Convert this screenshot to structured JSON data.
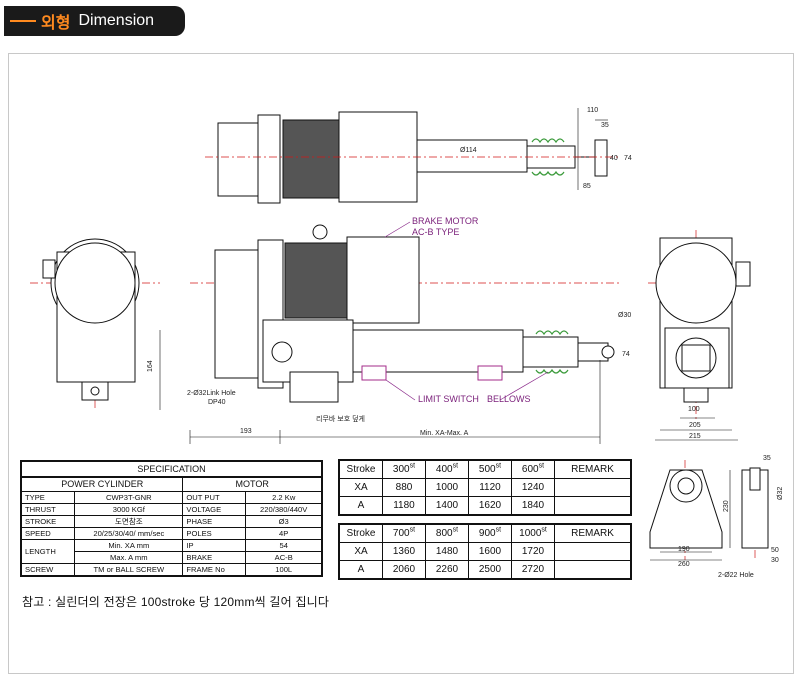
{
  "header": {
    "korean": "외형",
    "english": "Dimension"
  },
  "drawing": {
    "top_view": {
      "dim_110": "110",
      "dim_35": "35",
      "dim_40": "40",
      "dim_74": "74",
      "dim_85": "85",
      "dim_phi114": "Ø114"
    },
    "side_view": {
      "brake_motor_label": "BRAKE MOTOR",
      "brake_motor_type": "AC-B TYPE",
      "limit_switch_label": "LIMIT SWITCH",
      "bellows_label": "BELLOWS",
      "hole_label_1": "2-Ø32Link Hole",
      "hole_label_2": "DP40",
      "dim_164": "164",
      "dim_193": "193",
      "dim_phi30": "Ø30",
      "dim_74": "74",
      "length_label": "Min. XA-Max. A",
      "cover_label": "리무바 보호 덮게"
    },
    "end_view": {
      "dim_100": "100",
      "dim_205": "205",
      "dim_215": "215"
    },
    "bracket": {
      "dim_35": "35",
      "dim_230": "230",
      "dim_phi32": "Ø32",
      "dim_190": "190",
      "dim_260": "260",
      "dim_50": "50",
      "dim_30": "30",
      "hole_label": "2-Ø22 Hole"
    }
  },
  "spec_table": {
    "title": "SPECIFICATION",
    "col_power": "POWER CYLINDER",
    "col_motor": "MOTOR",
    "rows": [
      {
        "label": "TYPE",
        "value": "CWP3T-GNR",
        "mlabel": "OUT PUT",
        "mvalue": "2.2 Kw"
      },
      {
        "label": "THRUST",
        "value": "3000 KGf",
        "mlabel": "VOLTAGE",
        "mvalue": "220/380/440V"
      },
      {
        "label": "STROKE",
        "value": "도면참조",
        "mlabel": "PHASE",
        "mvalue": "Ø3"
      },
      {
        "label": "SPEED",
        "value": "20/25/30/40/ mm/sec",
        "mlabel": "POLES",
        "mvalue": "4P"
      }
    ],
    "length_label": "LENGTH",
    "length_rows": [
      {
        "value": "Min. XA mm",
        "mlabel": "IP",
        "mvalue": "54"
      },
      {
        "value": "Max. A mm",
        "mlabel": "BRAKE",
        "mvalue": "AC-B"
      }
    ],
    "last_row": {
      "label": "SCREW",
      "value": "TM or BALL SCREW",
      "mlabel": "FRAME No",
      "mvalue": "100L"
    }
  },
  "stroke_tables": [
    {
      "head": "Stroke",
      "sup": "st",
      "remark": "REMARK",
      "strokes": [
        "300",
        "400",
        "500",
        "600"
      ],
      "rows": [
        {
          "label": "XA",
          "values": [
            "880",
            "1000",
            "1120",
            "1240"
          ]
        },
        {
          "label": "A",
          "values": [
            "1180",
            "1400",
            "1620",
            "1840"
          ]
        }
      ]
    },
    {
      "head": "Stroke",
      "sup": "st",
      "remark": "REMARK",
      "strokes": [
        "700",
        "800",
        "900",
        "1000"
      ],
      "rows": [
        {
          "label": "XA",
          "values": [
            "1360",
            "1480",
            "1600",
            "1720"
          ]
        },
        {
          "label": "A",
          "values": [
            "2060",
            "2260",
            "2500",
            "2720"
          ]
        }
      ]
    }
  ],
  "footnote": "참고 : 실린더의 전장은 100stroke 당 120mm씩 길어 집니다",
  "colors": {
    "accent": "#ff8a1f",
    "header_bg": "#1a1a1a",
    "centerline": "#d11a1a",
    "bellows": "#3a9a3a",
    "leader": "#8a2a8a"
  }
}
